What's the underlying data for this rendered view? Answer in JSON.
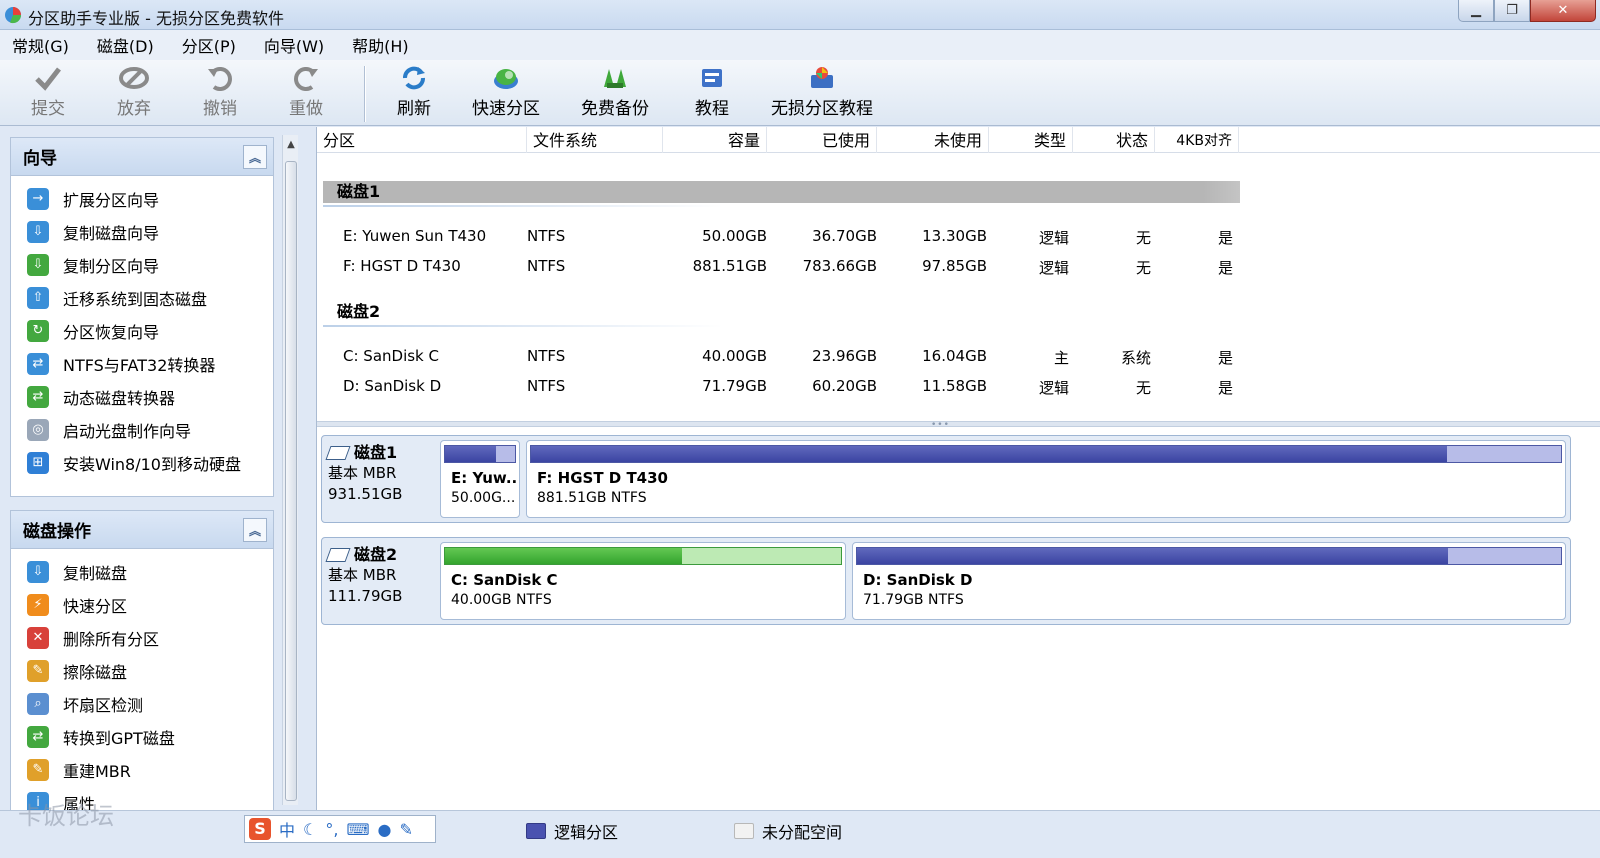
{
  "window": {
    "title": "分区助手专业版 - 无损分区免费软件",
    "controls": [
      "minimize",
      "restore",
      "close"
    ]
  },
  "menu": [
    "常规(G)",
    "磁盘(D)",
    "分区(P)",
    "向导(W)",
    "帮助(H)"
  ],
  "toolbar": [
    {
      "label": "提交",
      "icon": "check-icon",
      "enabled": false
    },
    {
      "label": "放弃",
      "icon": "discard-icon",
      "enabled": false
    },
    {
      "label": "撤销",
      "icon": "undo-icon",
      "enabled": false
    },
    {
      "label": "重做",
      "icon": "redo-icon",
      "enabled": false
    },
    {
      "label": "刷新",
      "icon": "refresh-icon",
      "enabled": true
    },
    {
      "label": "快速分区",
      "icon": "quick-partition-icon",
      "enabled": true
    },
    {
      "label": "免费备份",
      "icon": "backup-icon",
      "enabled": true
    },
    {
      "label": "教程",
      "icon": "tutorial-icon",
      "enabled": true
    },
    {
      "label": "无损分区教程",
      "icon": "lossless-tutorial-icon",
      "enabled": true
    }
  ],
  "wizard_group": {
    "title": "向导",
    "items": [
      "扩展分区向导",
      "复制磁盘向导",
      "复制分区向导",
      "迁移系统到固态磁盘",
      "分区恢复向导",
      "NTFS与FAT32转换器",
      "动态磁盘转换器",
      "启动光盘制作向导",
      "安装Win8/10到移动硬盘"
    ]
  },
  "disk_ops_group": {
    "title": "磁盘操作",
    "items": [
      "复制磁盘",
      "快速分区",
      "删除所有分区",
      "擦除磁盘",
      "坏扇区检测",
      "转换到GPT磁盘",
      "重建MBR",
      "属性"
    ]
  },
  "table": {
    "columns": [
      "分区",
      "文件系统",
      "容量",
      "已使用",
      "未使用",
      "类型",
      "状态",
      "4KB对齐"
    ],
    "disks": [
      {
        "name": "磁盘1",
        "rows": [
          [
            "E: Yuwen Sun T430",
            "NTFS",
            "50.00GB",
            "36.70GB",
            "13.30GB",
            "逻辑",
            "无",
            "是"
          ],
          [
            "F: HGST D T430",
            "NTFS",
            "881.51GB",
            "783.66GB",
            "97.85GB",
            "逻辑",
            "无",
            "是"
          ]
        ]
      },
      {
        "name": "磁盘2",
        "rows": [
          [
            "C: SanDisk C",
            "NTFS",
            "40.00GB",
            "23.96GB",
            "16.04GB",
            "主",
            "系统",
            "是"
          ],
          [
            "D: SanDisk D",
            "NTFS",
            "71.79GB",
            "60.20GB",
            "11.58GB",
            "逻辑",
            "无",
            "是"
          ]
        ]
      }
    ]
  },
  "disk_map": [
    {
      "name": "磁盘1",
      "type": "基本 MBR",
      "size": "931.51GB",
      "partitions": [
        {
          "name": "E: Yuw...",
          "info": "50.00G...",
          "used_fraction": 0.734,
          "kind": "logical"
        },
        {
          "name": "F: HGST D T430",
          "info": "881.51GB NTFS",
          "used_fraction": 0.889,
          "kind": "logical"
        }
      ]
    },
    {
      "name": "磁盘2",
      "type": "基本 MBR",
      "size": "111.79GB",
      "partitions": [
        {
          "name": "C: SanDisk C",
          "info": "40.00GB NTFS",
          "used_fraction": 0.599,
          "kind": "primary"
        },
        {
          "name": "D: SanDisk D",
          "info": "71.79GB NTFS",
          "used_fraction": 0.839,
          "kind": "logical"
        }
      ]
    }
  ],
  "legend": [
    {
      "label": "逻辑分区",
      "color": "#4a52b0"
    },
    {
      "label": "未分配空间",
      "color": "#f2f2f2"
    }
  ],
  "ime": {
    "label": "中"
  },
  "watermark": "卡饭论坛"
}
